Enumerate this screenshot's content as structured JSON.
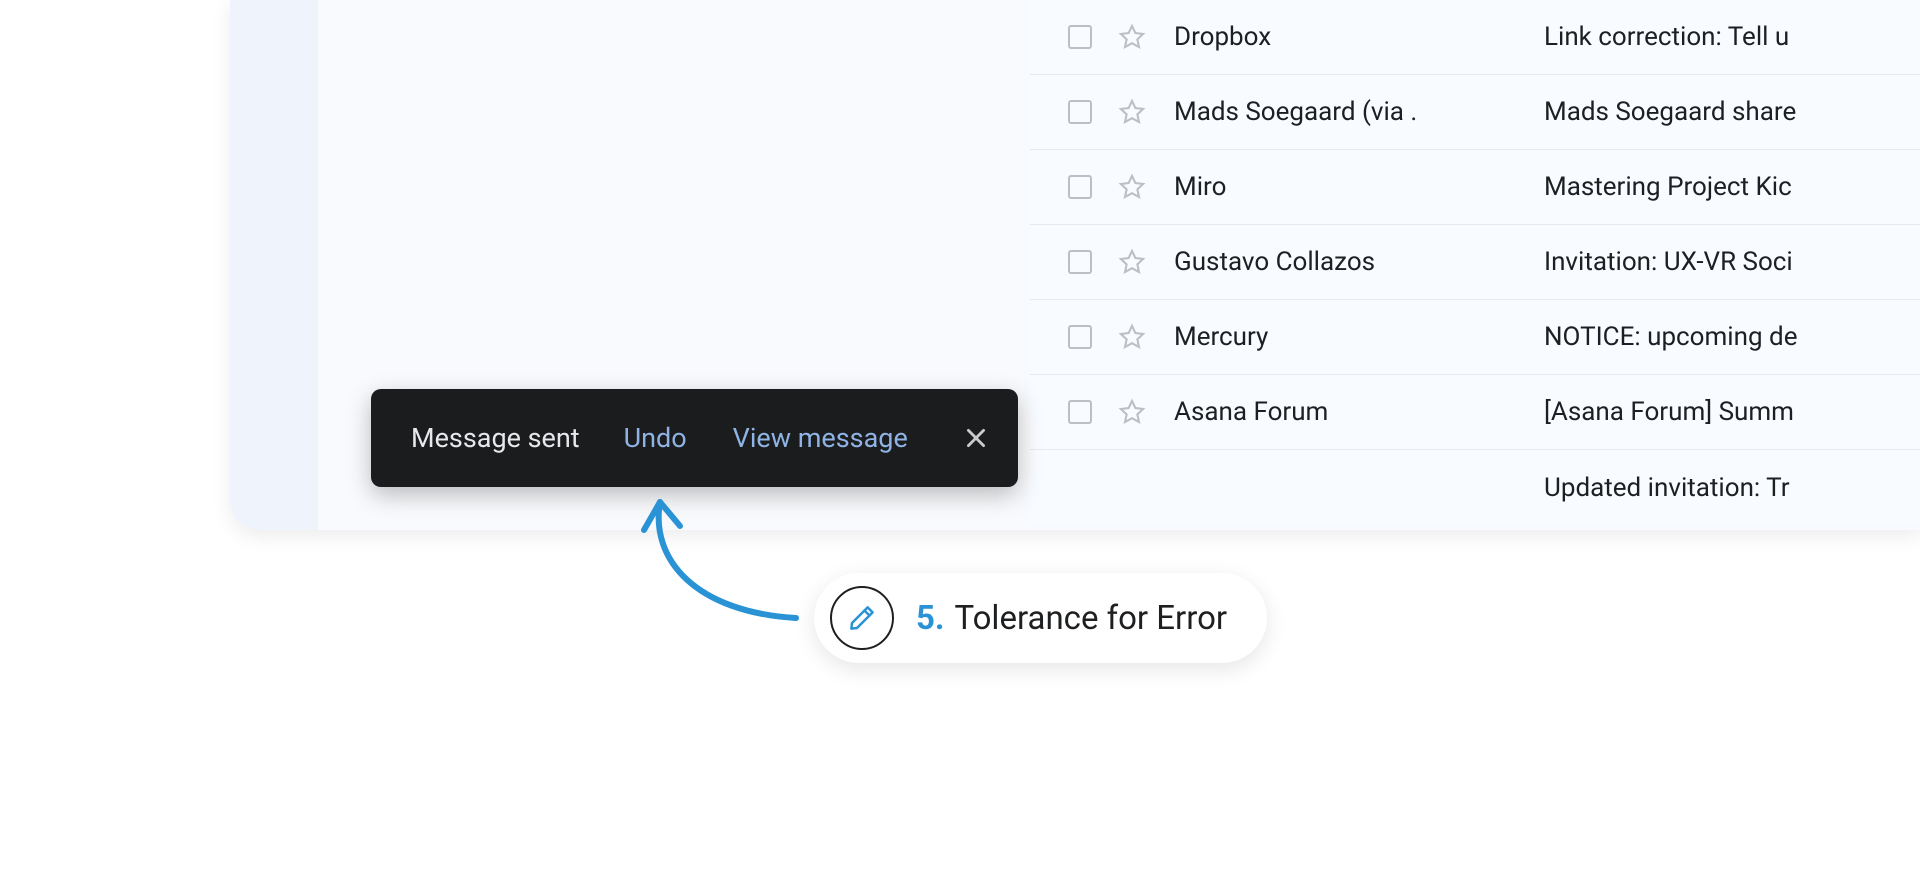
{
  "emails": [
    {
      "sender": "Dropbox",
      "subject": "Link correction: Tell u"
    },
    {
      "sender": "Mads Soegaard (via .",
      "subject": "Mads Soegaard share"
    },
    {
      "sender": "Miro",
      "subject": "Mastering Project Kic"
    },
    {
      "sender": "Gustavo Collazos",
      "subject": "Invitation: UX-VR Soci"
    },
    {
      "sender": "Mercury",
      "subject": "NOTICE: upcoming de"
    },
    {
      "sender": "Asana Forum",
      "subject": "[Asana Forum] Summ"
    },
    {
      "sender": "",
      "subject": "Updated invitation: Tr"
    }
  ],
  "toast": {
    "message": "Message sent",
    "undo_label": "Undo",
    "view_label": "View message"
  },
  "annotation": {
    "number": "5.",
    "title": "Tolerance for Error"
  }
}
